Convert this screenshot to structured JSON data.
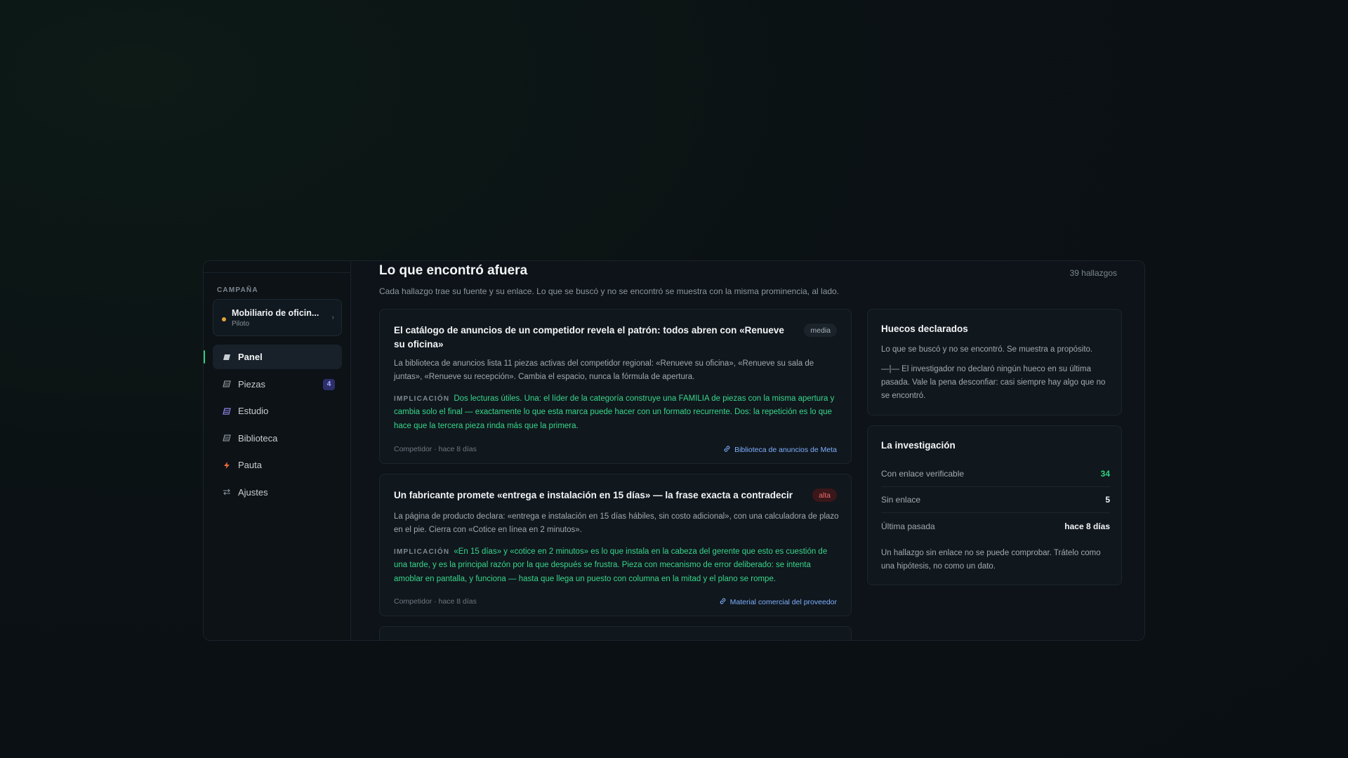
{
  "sidebar": {
    "section_label": "CAMPAÑA",
    "campaign": {
      "name": "Mobiliario de oficin...",
      "status": "Piloto",
      "status_color": "#e3a23b"
    },
    "items": [
      {
        "label": "Panel",
        "icon": "panel-icon",
        "active": true
      },
      {
        "label": "Piezas",
        "icon": "pieces-icon",
        "badge": "4"
      },
      {
        "label": "Estudio",
        "icon": "study-icon"
      },
      {
        "label": "Biblioteca",
        "icon": "library-icon"
      },
      {
        "label": "Pauta",
        "icon": "lightning-icon"
      },
      {
        "label": "Ajustes",
        "icon": "swap-arrows-icon"
      }
    ]
  },
  "main": {
    "title": "Lo que encontró afuera",
    "count": "39 hallazgos",
    "subtitle": "Cada hallazgo trae su fuente y su enlace. Lo que se buscó y no se encontró se muestra con la misma prominencia, al lado.",
    "findings": [
      {
        "title": "El catálogo de anuncios de un competidor revela el patrón: todos abren con «Renueve su oficina»",
        "confidence": "media",
        "body": "La biblioteca de anuncios lista 11 piezas activas del competidor regional: «Renueve su oficina», «Renueve su sala de juntas», «Renueve su recepción». Cambia el espacio, nunca la fórmula de apertura.",
        "implication_label": "IMPLICACIÓN",
        "implication": "Dos lecturas útiles. Una: el líder de la categoría construye una FAMILIA de piezas con la misma apertura y cambia solo el final — exactamente lo que esta marca puede hacer con un formato recurrente. Dos: la repetición es lo que hace que la tercera pieza rinda más que la primera.",
        "meta": "Competidor · hace 8 días",
        "source": "Biblioteca de anuncios de Meta"
      },
      {
        "title": "Un fabricante promete «entrega e instalación en 15 días» — la frase exacta a contradecir",
        "confidence": "alta",
        "body": "La página de producto declara: «entrega e instalación en 15 días hábiles, sin costo adicional», con una calculadora de plazo en el pie. Cierra con «Cotice en línea en 2 minutos».",
        "implication_label": "IMPLICACIÓN",
        "implication": "«En 15 días» y «cotice en 2 minutos» es lo que instala en la cabeza del gerente que esto es cuestión de una tarde, y es la principal razón por la que después se frustra. Pieza con mecanismo de error deliberado: se intenta amoblar en pantalla, y funciona — hasta que llega un puesto con columna en la mitad y el plano se rompe.",
        "meta": "Competidor · hace 8 días",
        "source": "Material comercial del proveedor"
      }
    ]
  },
  "gaps": {
    "title": "Huecos declarados",
    "lead": "Lo que se buscó y no se encontró. Se muestra a propósito.",
    "note": "—|— El investigador no declaró ningún hueco en su última pasada. Vale la pena desconfiar: casi siempre hay algo que no se encontró."
  },
  "research": {
    "title": "La investigación",
    "stats": [
      {
        "label": "Con enlace verificable",
        "value": "34",
        "color": "#2fd07d"
      },
      {
        "label": "Sin enlace",
        "value": "5"
      },
      {
        "label": "Última pasada",
        "value": "hace 8 días"
      }
    ],
    "note": "Un hallazgo sin enlace no se puede comprobar. Trátelo como una hipótesis, no como un dato."
  }
}
